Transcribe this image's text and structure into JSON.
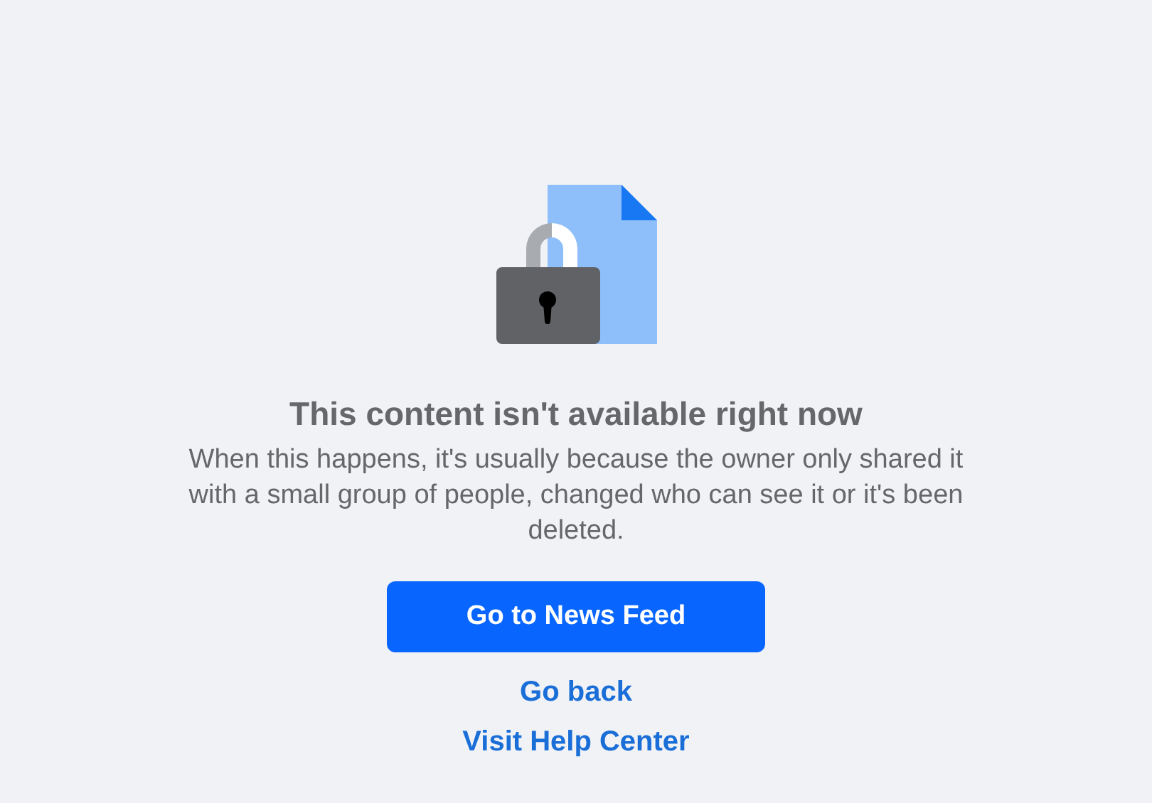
{
  "title": "This content isn't available right now",
  "message": "When this happens, it's usually because the owner only shared it with a small group of people, changed who can see it or it's been deleted.",
  "primary_button": "Go to News Feed",
  "links": [
    "Go back",
    "Visit Help Center"
  ]
}
